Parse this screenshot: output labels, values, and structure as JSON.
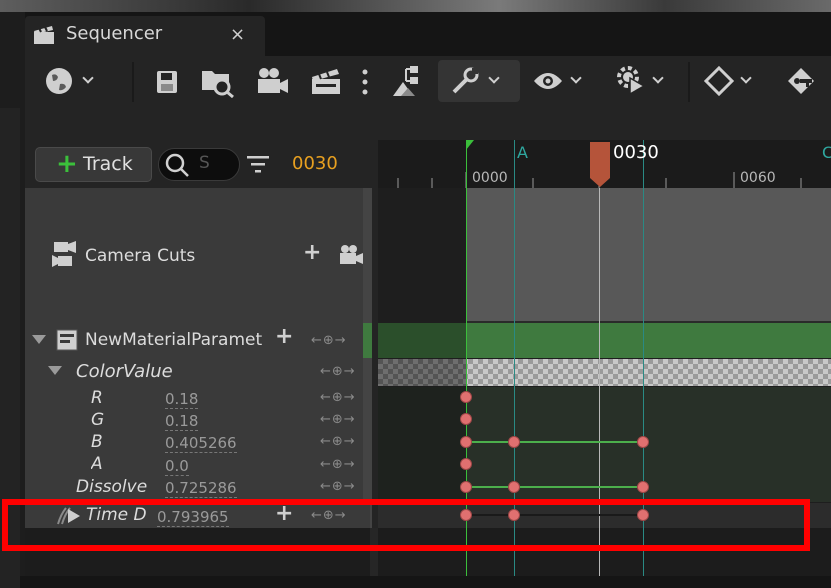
{
  "window": {
    "tab_title": "Sequencer",
    "close_glyph": "×"
  },
  "toolbar": {
    "icons": [
      "world-icon",
      "save-icon",
      "find-asset-icon",
      "camera-icon",
      "clapperboard-icon",
      "more-icon",
      "hierarchy-icon",
      "wrench-icon",
      "eye-icon",
      "gear-play-icon",
      "keyframe-icon",
      "key-icon"
    ]
  },
  "controls": {
    "track_plus": "+",
    "track_label": "Track",
    "search_placeholder": "S",
    "current_frame": "0030"
  },
  "ruler": {
    "marker_a": "A",
    "marker_c": "C",
    "playhead_label": "0030",
    "ticks": [
      "0000",
      "0060"
    ]
  },
  "tree": {
    "camera_cuts": "Camera Cuts",
    "material_track": "NewMaterialParameterCollection",
    "color_value": "ColorValue",
    "channels": [
      {
        "name": "R",
        "value": "0.18"
      },
      {
        "name": "G",
        "value": "0.18"
      },
      {
        "name": "B",
        "value": "0.405266"
      },
      {
        "name": "A",
        "value": "0.0"
      }
    ],
    "dissolve": {
      "name": "Dissolve",
      "value": "0.725286"
    },
    "time": {
      "name": "Time D",
      "value": "0.793965"
    }
  },
  "colors": {
    "accent_orange": "#e8a020",
    "track_green": "#3f7a3f",
    "key_red": "#e07070",
    "highlight_red": "#ff0000"
  }
}
